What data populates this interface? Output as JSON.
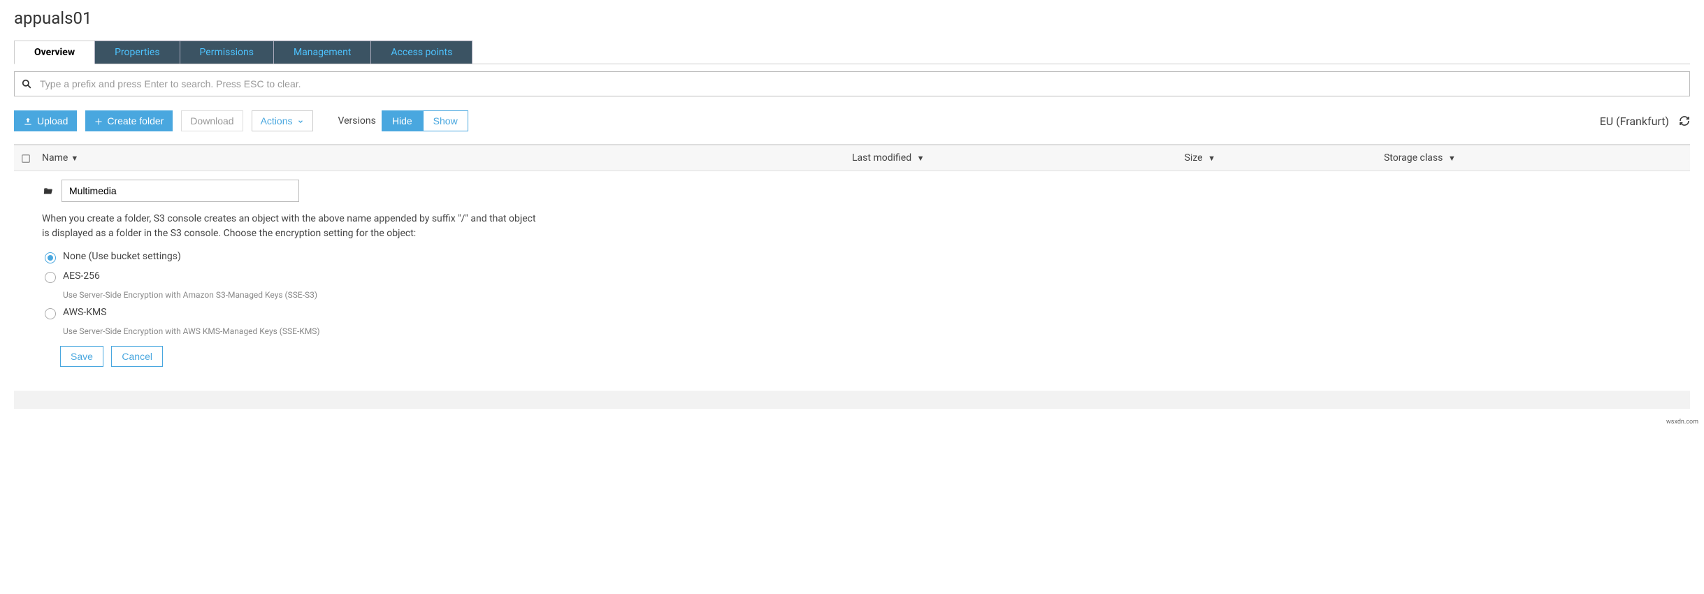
{
  "bucket": {
    "name": "appuals01"
  },
  "tabs": [
    "Overview",
    "Properties",
    "Permissions",
    "Management",
    "Access points"
  ],
  "search": {
    "placeholder": "Type a prefix and press Enter to search. Press ESC to clear."
  },
  "toolbar": {
    "upload": "Upload",
    "create_folder": "Create folder",
    "download": "Download",
    "actions": "Actions",
    "versions_label": "Versions",
    "hide": "Hide",
    "show": "Show",
    "region": "EU (Frankfurt)"
  },
  "columns": {
    "name": "Name",
    "last_modified": "Last modified",
    "size": "Size",
    "storage_class": "Storage class"
  },
  "folder_form": {
    "value": "Multimedia",
    "help": "When you create a folder, S3 console creates an object with the above name appended by suffix \"/\" and that object is displayed as a folder in the S3 console. Choose the encryption setting for the object:",
    "opt_none_label": "None (Use bucket settings)",
    "opt_aes_label": "AES-256",
    "opt_aes_desc": "Use Server-Side Encryption with Amazon S3-Managed Keys (SSE-S3)",
    "opt_kms_label": "AWS-KMS",
    "opt_kms_desc": "Use Server-Side Encryption with AWS KMS-Managed Keys (SSE-KMS)",
    "save": "Save",
    "cancel": "Cancel"
  },
  "attrib": "wsxdn.com"
}
